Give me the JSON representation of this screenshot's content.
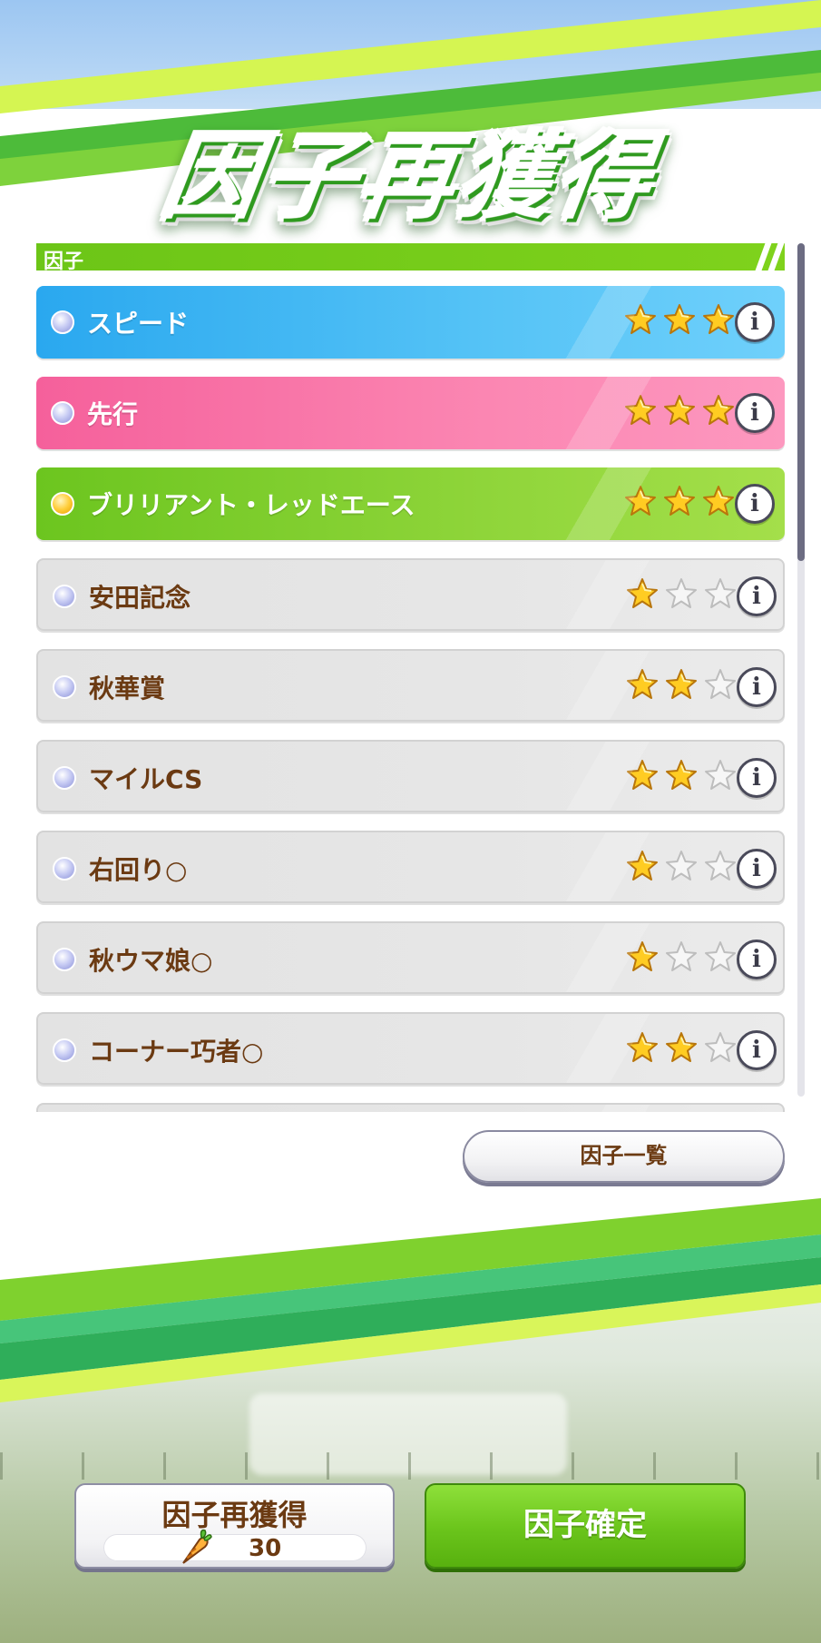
{
  "title": "因子再獲得",
  "section": {
    "label": "因子"
  },
  "factors": [
    {
      "name": "スピード",
      "rating": 3,
      "max": 3,
      "color": "blue"
    },
    {
      "name": "先行",
      "rating": 3,
      "max": 3,
      "color": "pink"
    },
    {
      "name": "ブリリアント・レッドエース",
      "rating": 3,
      "max": 3,
      "color": "green"
    },
    {
      "name": "安田記念",
      "rating": 1,
      "max": 3,
      "color": "gray"
    },
    {
      "name": "秋華賞",
      "rating": 2,
      "max": 3,
      "color": "gray"
    },
    {
      "name": "マイルCS",
      "rating": 2,
      "max": 3,
      "color": "gray"
    },
    {
      "name": "右回り○",
      "rating": 1,
      "max": 3,
      "color": "gray"
    },
    {
      "name": "秋ウマ娘○",
      "rating": 1,
      "max": 3,
      "color": "gray"
    },
    {
      "name": "コーナー巧者○",
      "rating": 2,
      "max": 3,
      "color": "gray"
    }
  ],
  "list_button": {
    "label": "因子一覧"
  },
  "footer": {
    "reacquire_label": "因子再獲得",
    "reacquire_cost": "30",
    "confirm_label": "因子確定"
  },
  "colors": {
    "accent_green": "#6cc517",
    "text_brown": "#6b3a12",
    "star_gold": "#ffcc22"
  }
}
